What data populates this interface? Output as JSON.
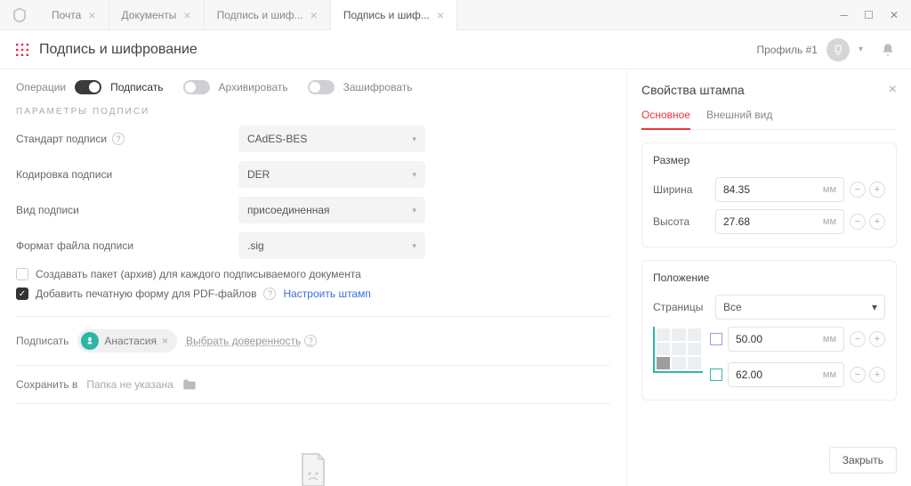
{
  "tabs": [
    {
      "label": "Почта"
    },
    {
      "label": "Документы"
    },
    {
      "label": "Подпись и шиф..."
    },
    {
      "label": "Подпись и шиф..."
    }
  ],
  "page_title": "Подпись и шифрование",
  "profile_label": "Профиль #1",
  "operations": {
    "title": "Операции",
    "sign": "Подписать",
    "archive": "Архивировать",
    "encrypt": "Зашифровать"
  },
  "params": {
    "section": "ПАРАМЕТРЫ ПОДПИСИ",
    "standard_label": "Стандарт подписи",
    "standard_value": "CAdES-BES",
    "encoding_label": "Кодировка подписи",
    "encoding_value": "DER",
    "type_label": "Вид подписи",
    "type_value": "присоединенная",
    "format_label": "Формат файла подписи",
    "format_value": ".sig",
    "pack_label": "Создавать пакет (архив) для каждого подписываемого документа",
    "print_label": "Добавить печатную форму для PDF-файлов",
    "stamp_link": "Настроить штамп"
  },
  "signer": {
    "label": "Подписать",
    "chip": "Анастасия",
    "attorney": "Выбрать доверенность"
  },
  "save": {
    "label": "Сохранить в",
    "placeholder": "Папка не указана"
  },
  "panel": {
    "title": "Свойства штампа",
    "tab_main": "Основное",
    "tab_view": "Внешний вид",
    "size_title": "Размер",
    "width_label": "Ширина",
    "width_value": "84.35",
    "height_label": "Высота",
    "height_value": "27.68",
    "unit": "мм",
    "pos_title": "Положение",
    "pages_label": "Страницы",
    "pages_value": "Все",
    "x_value": "50.00",
    "y_value": "62.00",
    "close": "Закрыть"
  }
}
